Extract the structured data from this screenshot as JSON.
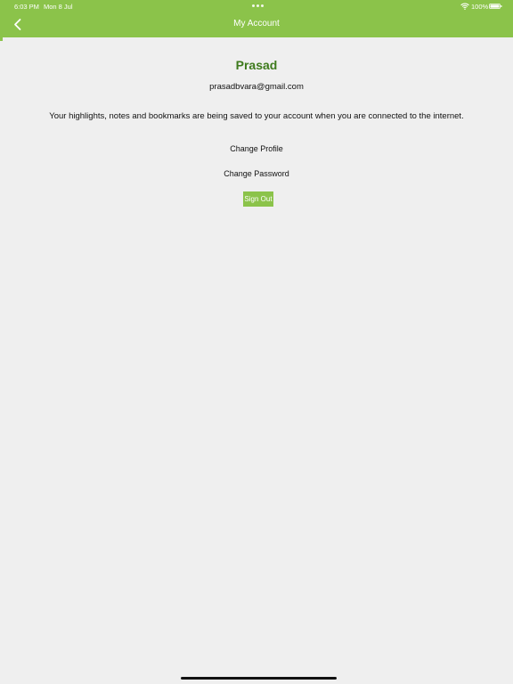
{
  "status_bar": {
    "time": "6:03 PM",
    "date": "Mon 8 Jul",
    "battery": "100%",
    "wifi_icon": "wifi-icon",
    "battery_icon": "battery-icon",
    "multitask_icon": "ellipsis-icon"
  },
  "nav": {
    "title": "My Account",
    "back_icon": "chevron-left-icon"
  },
  "account": {
    "name": "Prasad",
    "email": "prasadbvara@gmail.com",
    "message": "Your highlights, notes and bookmarks are being saved to your account when you are connected to the internet."
  },
  "actions": {
    "change_profile": "Change Profile",
    "change_password": "Change Password",
    "sign_out": "Sign Out"
  },
  "colors": {
    "accent": "#8bc34a",
    "name_text": "#3d7a1c",
    "background": "#efefef"
  }
}
